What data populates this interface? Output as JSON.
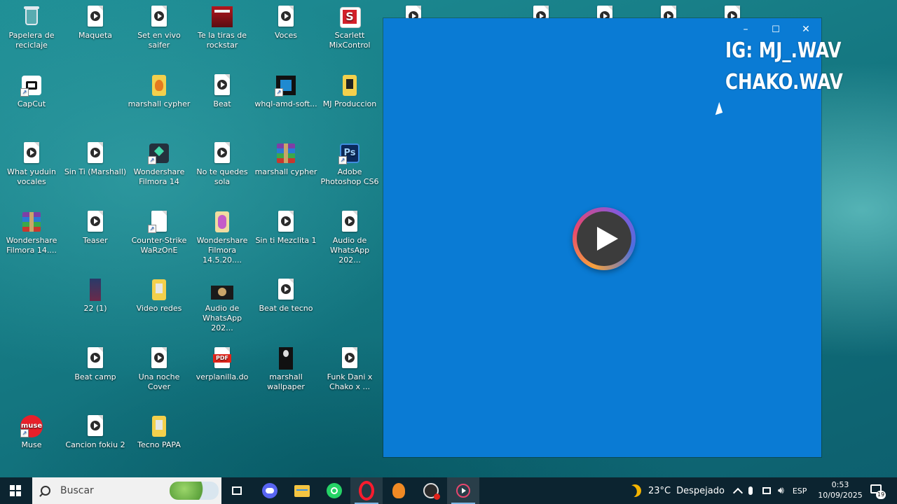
{
  "desktop_icons": [
    {
      "label": "Papelera de reciclaje",
      "icon": "recycle-bin-icon"
    },
    {
      "label": "Maqueta",
      "icon": "media-file-icon"
    },
    {
      "label": "Set en vivo saifer",
      "icon": "media-file-icon"
    },
    {
      "label": "Te la tiras de rockstar",
      "icon": "image-thumbnail-icon"
    },
    {
      "label": "Voces",
      "icon": "media-file-icon"
    },
    {
      "label": "Scarlett MixControl",
      "icon": "scarlett-icon"
    },
    {
      "label": "CapCut",
      "icon": "capcut-icon"
    },
    {
      "label": "marshall cypher",
      "icon": "fl-project-icon"
    },
    {
      "label": "Beat",
      "icon": "media-file-icon"
    },
    {
      "label": "whql-amd-soft...",
      "icon": "amd-icon"
    },
    {
      "label": "MJ Produccion",
      "icon": "folder-icon"
    },
    {
      "label": "What yuduin vocales",
      "icon": "media-file-icon"
    },
    {
      "label": "Sin Ti (Marshall)",
      "icon": "media-file-icon"
    },
    {
      "label": "Wondershare Filmora 14",
      "icon": "filmora-icon"
    },
    {
      "label": "No te quedes sola",
      "icon": "media-file-icon"
    },
    {
      "label": "marshall cypher",
      "icon": "winrar-icon"
    },
    {
      "label": "Adobe Photoshop CS6",
      "icon": "photoshop-icon"
    },
    {
      "label": "Wondershare Filmora 14....",
      "icon": "winrar-icon"
    },
    {
      "label": "Teaser",
      "icon": "media-file-icon"
    },
    {
      "label": "Counter-Strike WaRzOnE",
      "icon": "blank-file-icon"
    },
    {
      "label": "Wondershare Filmora 14.5.20....",
      "icon": "installer-icon"
    },
    {
      "label": "Sin ti Mezclita 1",
      "icon": "media-file-icon"
    },
    {
      "label": "Audio de WhatsApp 202...",
      "icon": "media-file-icon"
    },
    {
      "label": "22 (1)",
      "icon": "image-thumbnail-icon"
    },
    {
      "label": "Video redes",
      "icon": "folder-icon"
    },
    {
      "label": "Audio de WhatsApp 202...",
      "icon": "video-thumbnail-icon"
    },
    {
      "label": "Beat de tecno",
      "icon": "media-file-icon"
    },
    {
      "label": "Beat camp",
      "icon": "media-file-icon"
    },
    {
      "label": "Una noche Cover",
      "icon": "media-file-icon"
    },
    {
      "label": "verplanilla.do",
      "icon": "pdf-icon"
    },
    {
      "label": "marshall wallpaper",
      "icon": "image-thumbnail-icon"
    },
    {
      "label": "Funk Dani x Chako x ...",
      "icon": "media-file-icon"
    },
    {
      "label": "Muse",
      "icon": "muse-icon"
    },
    {
      "label": "Cancion fokiu 2",
      "icon": "media-file-icon"
    },
    {
      "label": "Tecno PAPA",
      "icon": "folder-icon"
    }
  ],
  "player_window": {
    "controls": {
      "minimize": "–",
      "maximize": "☐",
      "close": "✕"
    },
    "play_icon": "play-icon"
  },
  "watermark": {
    "line1": "IG: MJ_.WAV",
    "line2": "CHAKO.WAV"
  },
  "taskbar": {
    "search_placeholder": "Buscar",
    "weather_temp": "23°C",
    "weather_desc": "Despejado",
    "language": "ESP",
    "time": "0:53",
    "date": "10/09/2025",
    "notifications": "19",
    "pinned": [
      "task-view-icon",
      "discord-icon",
      "file-explorer-icon",
      "whatsapp-icon",
      "opera-icon",
      "fl-studio-icon",
      "obs-icon",
      "media-player-icon"
    ]
  }
}
